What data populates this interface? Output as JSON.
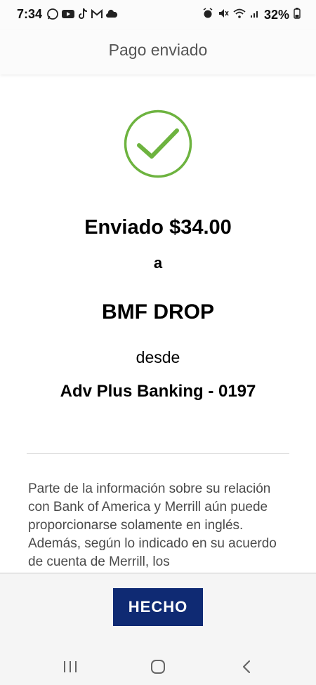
{
  "status_bar": {
    "time": "7:34",
    "left_icons": [
      "whatsapp-icon",
      "youtube-icon",
      "tiktok-icon",
      "gmail-icon",
      "cloud-icon"
    ],
    "right_icons": [
      "alarm-icon",
      "mute-icon",
      "wifi-icon",
      "signal-icon"
    ],
    "battery": "32%"
  },
  "header": {
    "title": "Pago enviado"
  },
  "confirmation": {
    "icon": "check-circle-icon",
    "sent_amount": "Enviado $34.00",
    "to_label": "a",
    "recipient": "BMF DROP",
    "from_label": "desde",
    "account": "Adv Plus Banking - 0197",
    "accent_color": "#6db33f"
  },
  "disclaimer": {
    "text": "Parte de la información sobre su relación con Bank of America y Merrill aún puede proporcionarse solamente en inglés. Además, según lo indicado en su acuerdo de cuenta de Merrill, los"
  },
  "actions": {
    "done_label": "HECHO",
    "button_color": "#0f2a73"
  },
  "nav_bar": {
    "icons": [
      "recent-apps-icon",
      "home-icon",
      "back-icon"
    ]
  }
}
